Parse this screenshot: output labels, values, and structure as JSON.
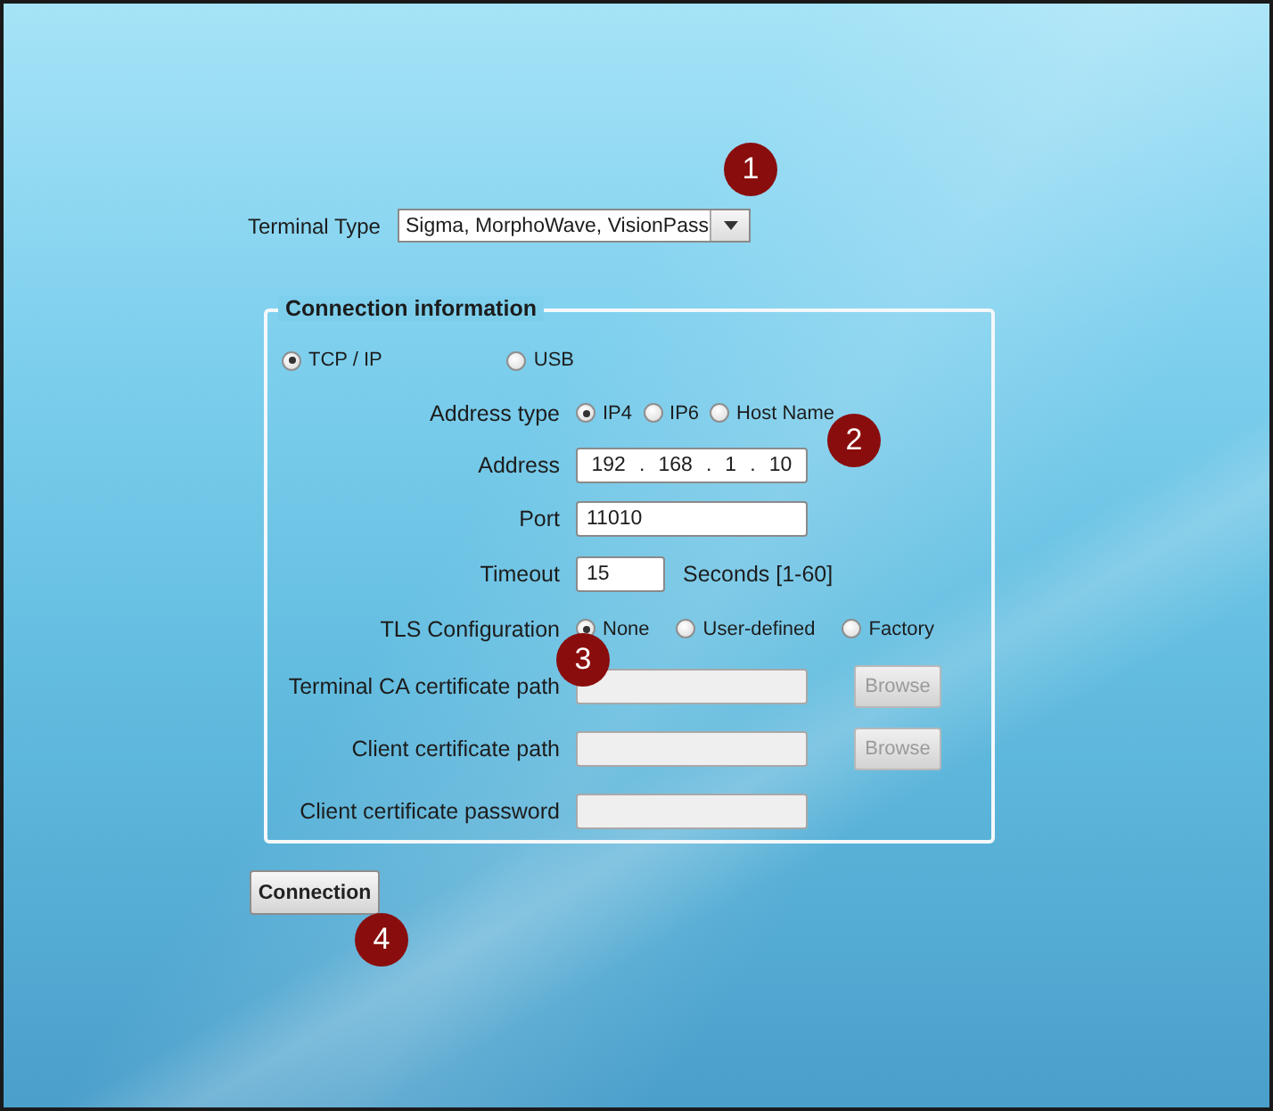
{
  "terminal_type": {
    "label": "Terminal Type",
    "value": "Sigma, MorphoWave, VisionPass"
  },
  "connection": {
    "legend": "Connection information",
    "modes": [
      {
        "label": "TCP / IP",
        "selected": true
      },
      {
        "label": "USB",
        "selected": false
      }
    ],
    "rows": [
      {
        "kind": "radios",
        "label": "Address type",
        "options": [
          {
            "label": "IP4",
            "selected": true
          },
          {
            "label": "IP6",
            "selected": false
          },
          {
            "label": "Host Name",
            "selected": false
          }
        ]
      },
      {
        "kind": "ip",
        "label": "Address",
        "octets": [
          "192",
          "168",
          "1",
          "10"
        ],
        "separator": "."
      },
      {
        "kind": "field",
        "label": "Port",
        "value": "11010",
        "disabled": false
      },
      {
        "kind": "short_field",
        "label": "Timeout",
        "value": "15",
        "disabled": false,
        "suffix": "Seconds [1-60]"
      },
      {
        "kind": "radios",
        "label": "TLS Configuration",
        "options": [
          {
            "label": "None",
            "selected": true
          },
          {
            "label": "User-defined",
            "selected": false
          },
          {
            "label": "Factory",
            "selected": false
          }
        ]
      },
      {
        "kind": "field",
        "label": "Terminal CA certificate path",
        "value": "",
        "disabled": true,
        "button": {
          "label": "Browse",
          "disabled": true
        }
      },
      {
        "kind": "field",
        "label": "Client certificate path",
        "value": "",
        "disabled": true,
        "button": {
          "label": "Browse",
          "disabled": true
        }
      },
      {
        "kind": "field",
        "label": "Client certificate password",
        "value": "",
        "disabled": true
      }
    ]
  },
  "connect_button": {
    "label": "Connection"
  },
  "callouts": [
    "1",
    "2",
    "3",
    "4"
  ]
}
